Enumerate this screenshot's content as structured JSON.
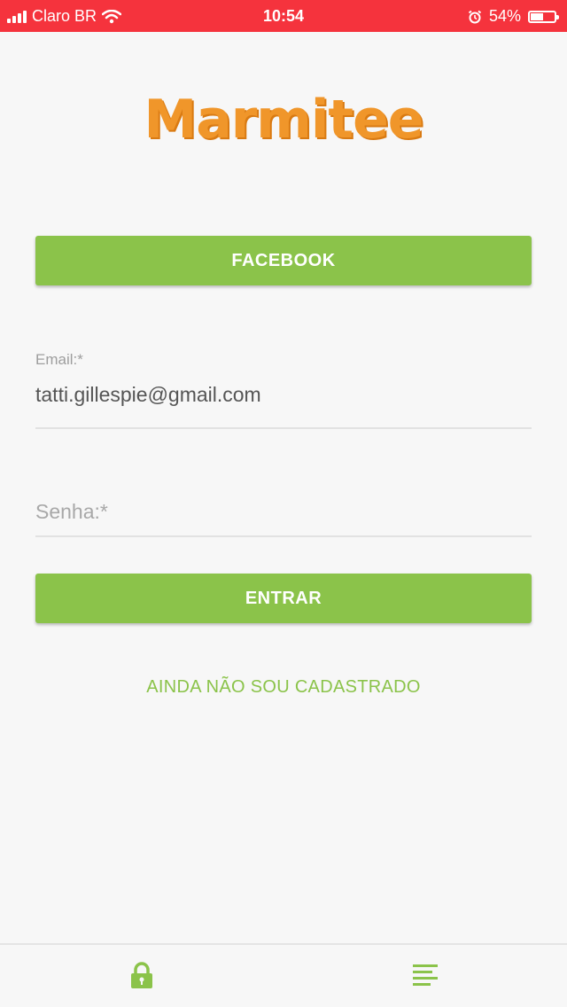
{
  "status_bar": {
    "carrier": "Claro BR",
    "time": "10:54",
    "battery": "54%",
    "battery_level": 0.54
  },
  "app": {
    "logo_text": "Marmitee",
    "logo_color": "#f0962a",
    "accent_color": "#8bc34a"
  },
  "login": {
    "facebook_label": "FACEBOOK",
    "email_label": "Email:*",
    "email_value": "tatti.gillespie@gmail.com",
    "password_placeholder": "Senha:*",
    "submit_label": "ENTRAR",
    "register_link": "AINDA NÃO SOU CADASTRADO"
  },
  "bottom_nav": {
    "items": [
      {
        "icon": "lock-icon"
      },
      {
        "icon": "menu-icon"
      }
    ]
  }
}
